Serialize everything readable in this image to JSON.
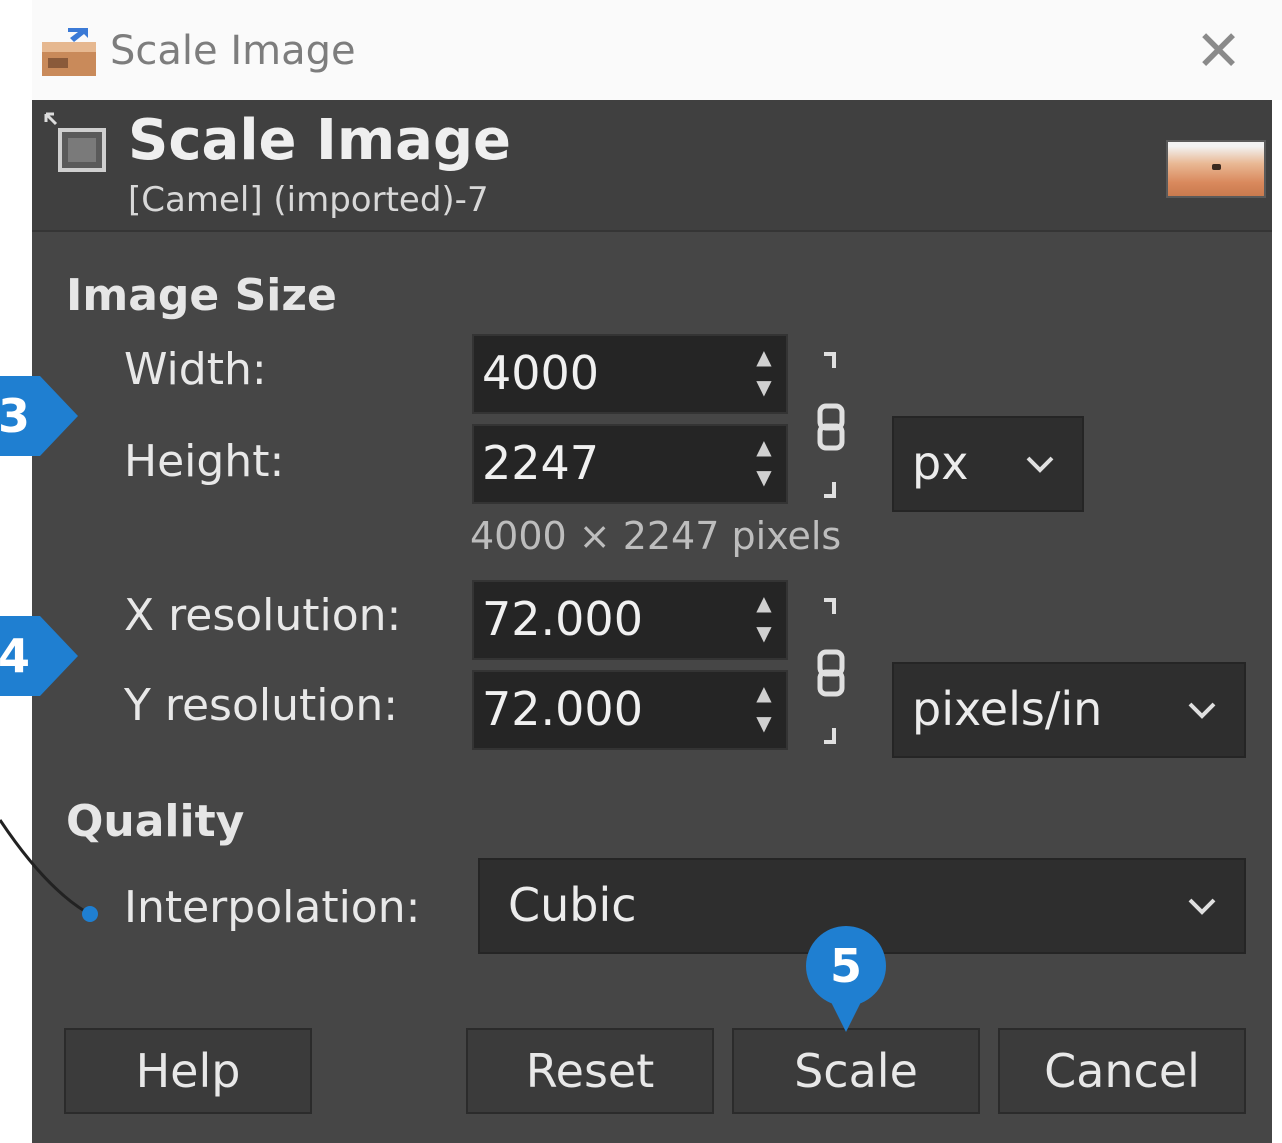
{
  "window": {
    "title": "Scale Image"
  },
  "header": {
    "title": "Scale Image",
    "subtitle": "[Camel] (imported)-7"
  },
  "image_size": {
    "section_label": "Image Size",
    "width_label": "Width:",
    "width_value": "4000",
    "height_label": "Height:",
    "height_value": "2247",
    "unit": "px",
    "pixel_info": "4000 × 2247 pixels"
  },
  "resolution": {
    "x_label": "X resolution:",
    "x_value": "72.000",
    "y_label": "Y resolution:",
    "y_value": "72.000",
    "unit": "pixels/in"
  },
  "quality": {
    "section_label": "Quality",
    "interpolation_label": "Interpolation:",
    "interpolation_value": "Cubic"
  },
  "buttons": {
    "help": "Help",
    "reset": "Reset",
    "scale": "Scale",
    "cancel": "Cancel"
  },
  "markers": {
    "m3": "3",
    "m4": "4",
    "m5": "5"
  },
  "colors": {
    "dialog_bg": "#464646",
    "marker_blue": "#1f7fd1"
  },
  "icons": {
    "close": "close-icon",
    "app": "scale-image-icon",
    "dropdown": "chevron-down-icon"
  }
}
